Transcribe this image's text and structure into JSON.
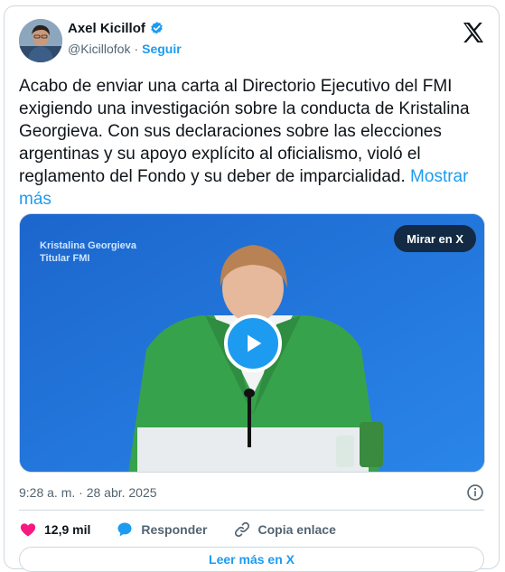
{
  "author": {
    "name": "Axel Kicillof",
    "handle": "@Kicillofok",
    "separator": "·",
    "follow_label": "Seguir"
  },
  "tweet": {
    "text": "Acabo de enviar una carta al Directorio Ejecutivo del FMI exigiendo una investigación sobre la conducta de Kristalina Georgieva. Con sus declaraciones sobre las elecciones argentinas y su apoyo explícito al oficialismo, violó el reglamento del Fondo y su deber de imparcialidad.",
    "more_label": "Mostrar más",
    "timestamp": "9:28 a. m. · 28 abr. 2025"
  },
  "media": {
    "caption_line1": "Kristalina Georgieva",
    "caption_line2": "Titular FMI",
    "watch_label": "Mirar en X"
  },
  "actions": {
    "likes": "12,9 mil",
    "reply_label": "Responder",
    "copy_label": "Copia enlace"
  },
  "footer": {
    "read_more_label": "Leer más en X"
  },
  "colors": {
    "accent": "#1d9bf0",
    "like": "#f91880",
    "text": "#0f1419",
    "muted": "#536471"
  },
  "icons": [
    "verified-badge-icon",
    "x-logo-icon",
    "play-icon",
    "info-icon",
    "heart-icon",
    "reply-icon",
    "link-icon"
  ]
}
